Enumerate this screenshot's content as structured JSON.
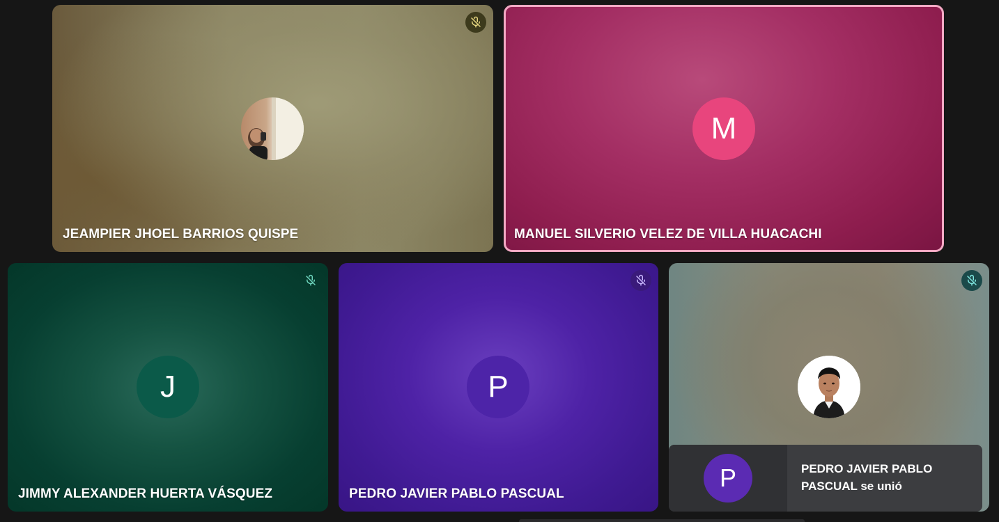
{
  "participants": [
    {
      "name": "JEAMPIER JHOEL BARRIOS QUISPE",
      "avatar_type": "photo",
      "muted": true,
      "mic_icon": "mic-off-icon"
    },
    {
      "name": "MANUEL SILVERIO VELEZ DE VILLA HUACACHI",
      "avatar_type": "initial",
      "avatar_letter": "M",
      "avatar_color": "#e8457d",
      "muted": false,
      "speaking": true,
      "highlight_color": "#f4a9c4"
    },
    {
      "name": "JIMMY ALEXANDER HUERTA VÁSQUEZ",
      "avatar_type": "initial",
      "avatar_letter": "J",
      "avatar_color": "#0b5a49",
      "muted": true,
      "mic_icon": "mic-off-icon"
    },
    {
      "name": "PEDRO JAVIER PABLO PASCUAL",
      "avatar_type": "initial",
      "avatar_letter": "P",
      "avatar_color": "#4d24a8",
      "muted": true,
      "mic_icon": "mic-off-icon"
    },
    {
      "name": "PEDRO JAVIER PABLO PASCUAL",
      "avatar_type": "photo",
      "muted": true,
      "mic_icon": "mic-off-icon"
    }
  ],
  "toast": {
    "avatar_letter": "P",
    "avatar_color": "#5b2bb3",
    "message": "PEDRO JAVIER PABLO PASCUAL se unió"
  },
  "colors": {
    "background": "#161616"
  }
}
